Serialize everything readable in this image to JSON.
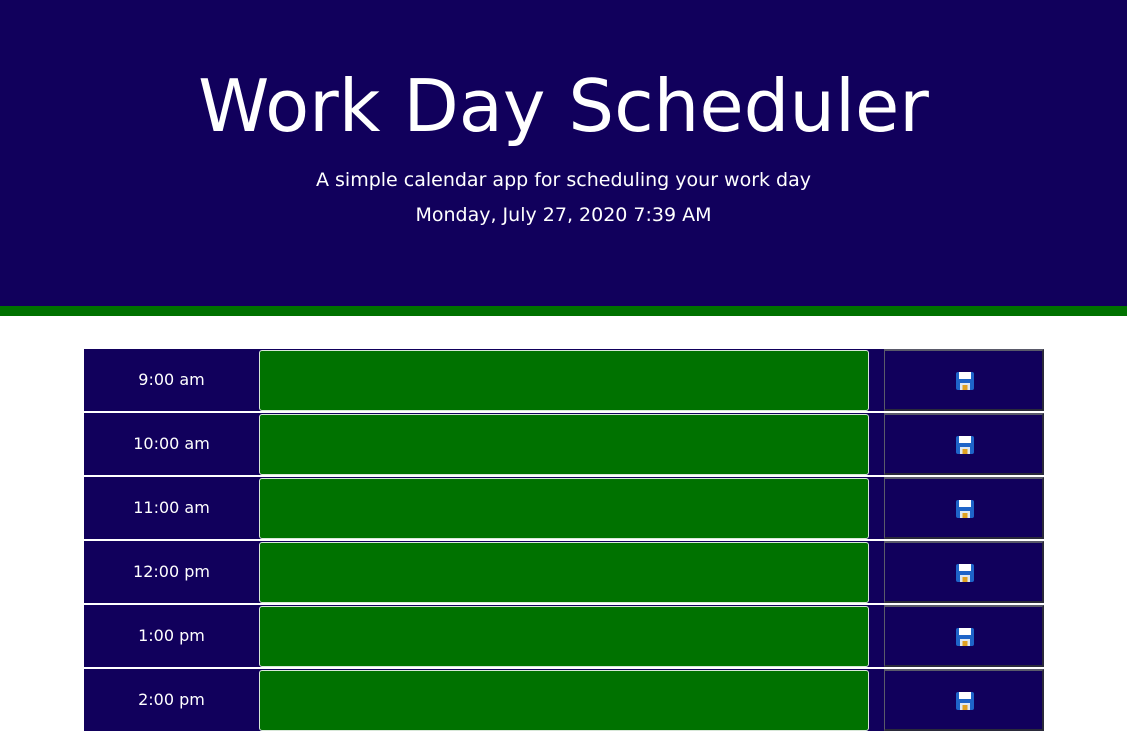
{
  "header": {
    "title": "Work Day Scheduler",
    "subtitle": "A simple calendar app for scheduling your work day",
    "current_datetime": "Monday, July 27, 2020 7:39 AM"
  },
  "colors": {
    "header_bg": "#11005c",
    "accent": "#007200",
    "hour_bg": "#11005c",
    "text": "#ffffff"
  },
  "schedule": {
    "rows": [
      {
        "hour": "9:00 am",
        "event": "",
        "save_icon": "floppy-disk-icon"
      },
      {
        "hour": "10:00 am",
        "event": "",
        "save_icon": "floppy-disk-icon"
      },
      {
        "hour": "11:00 am",
        "event": "",
        "save_icon": "floppy-disk-icon"
      },
      {
        "hour": "12:00 pm",
        "event": "",
        "save_icon": "floppy-disk-icon"
      },
      {
        "hour": "1:00 pm",
        "event": "",
        "save_icon": "floppy-disk-icon"
      },
      {
        "hour": "2:00 pm",
        "event": "",
        "save_icon": "floppy-disk-icon"
      }
    ]
  }
}
